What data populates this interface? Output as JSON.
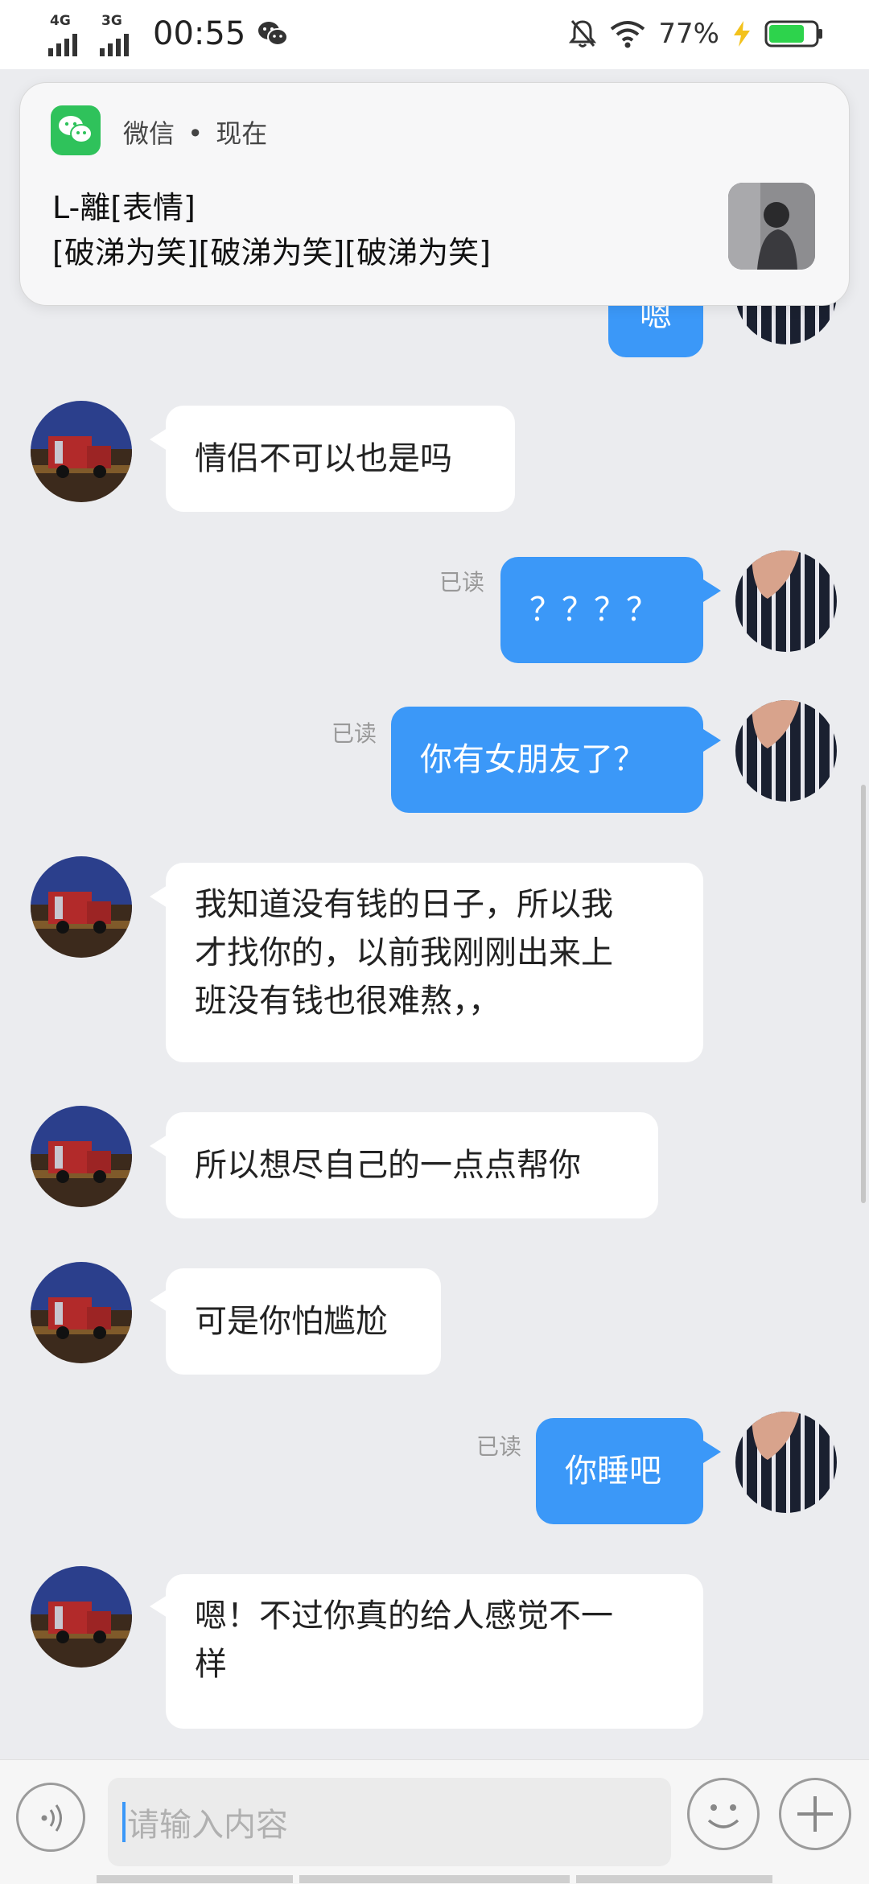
{
  "status_bar": {
    "net1": "4G",
    "net2": "3G",
    "time": "00:55",
    "battery_percent": "77%",
    "battery_level": 0.77,
    "charging": true
  },
  "notification": {
    "app_name": "微信",
    "separator": "•",
    "time": "现在",
    "sender": "L-離[表情]",
    "body": "[破涕为笑][破涕为笑][破涕为笑]"
  },
  "messages": [
    {
      "id": "m0",
      "side": "out",
      "text": "嗯",
      "read": ""
    },
    {
      "id": "m1",
      "side": "in",
      "text": "情侣不可以也是吗"
    },
    {
      "id": "m2",
      "side": "out",
      "text": "？？？？",
      "read": "已读"
    },
    {
      "id": "m3",
      "side": "out",
      "text": "你有女朋友了？",
      "read": "已读"
    },
    {
      "id": "m4",
      "side": "in",
      "lines": [
        "我知道没有钱的日子，所以我",
        "才找你的，以前我刚刚出来上",
        "班没有钱也很难熬，，"
      ]
    },
    {
      "id": "m5",
      "side": "in",
      "text": "所以想尽自己的一点点帮你"
    },
    {
      "id": "m6",
      "side": "in",
      "text": "可是你怕尴尬"
    },
    {
      "id": "m7",
      "side": "out",
      "text": "你睡吧",
      "read": "已读"
    },
    {
      "id": "m8",
      "side": "in",
      "lines": [
        "嗯！不过你真的给人感觉不一",
        "样"
      ]
    }
  ],
  "input": {
    "placeholder": "请输入内容"
  },
  "icons": {
    "voice": "voice-icon",
    "emoji": "emoji-icon",
    "plus": "plus-icon",
    "wechat": "wechat-icon"
  },
  "colors": {
    "outgoing_bubble": "#3b98f8",
    "incoming_bubble": "#ffffff",
    "chat_bg": "#ebecef",
    "wechat_green": "#2fc25b"
  }
}
